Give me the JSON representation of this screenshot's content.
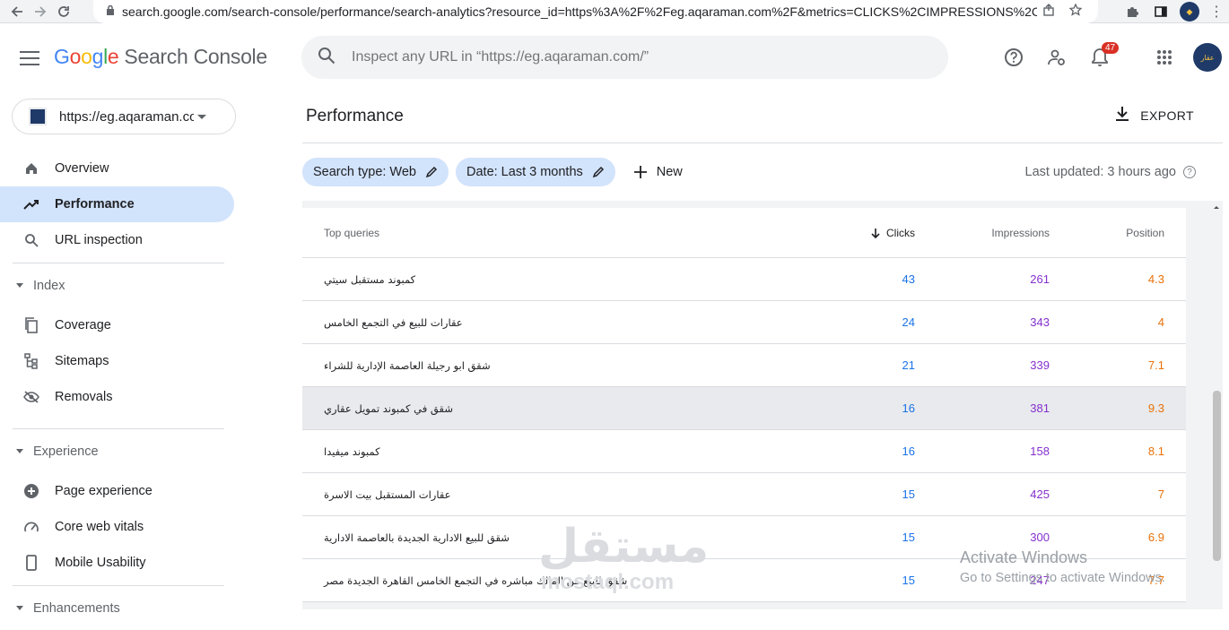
{
  "browser": {
    "url": "search.google.com/search-console/performance/search-analytics?resource_id=https%3A%2F%2Feg.aqaraman.com%2F&metrics=CLICKS%2CIMPRESSIONS%2CPO..."
  },
  "header": {
    "logo_google": [
      "G",
      "o",
      "o",
      "g",
      "l",
      "e"
    ],
    "logo_product": "Search Console",
    "search_placeholder": "Inspect any URL in “https://eg.aqaraman.com/”",
    "notifications_count": "47",
    "avatar_text": "عقار"
  },
  "sidebar": {
    "property": "https://eg.aqaraman.com/",
    "items": [
      {
        "label": "Overview",
        "icon": "home-icon"
      },
      {
        "label": "Performance",
        "icon": "trending-up-icon",
        "active": true
      },
      {
        "label": "URL inspection",
        "icon": "search-icon"
      }
    ],
    "sections": [
      {
        "label": "Index",
        "items": [
          {
            "label": "Coverage",
            "icon": "file-copy-icon"
          },
          {
            "label": "Sitemaps",
            "icon": "sitemap-icon"
          },
          {
            "label": "Removals",
            "icon": "eye-off-icon"
          }
        ]
      },
      {
        "label": "Experience",
        "items": [
          {
            "label": "Page experience",
            "icon": "add-circle-icon"
          },
          {
            "label": "Core web vitals",
            "icon": "speedometer-icon"
          },
          {
            "label": "Mobile Usability",
            "icon": "phone-icon"
          }
        ]
      },
      {
        "label": "Enhancements",
        "items": []
      }
    ]
  },
  "main": {
    "title": "Performance",
    "export_label": "EXPORT",
    "filters": [
      "Search type: Web",
      "Date: Last 3 months"
    ],
    "new_label": "New",
    "last_updated": "Last updated: 3 hours ago",
    "table": {
      "headers": [
        "Top queries",
        "Clicks",
        "Impressions",
        "Position"
      ],
      "rows": [
        {
          "query": "كمبوند مستقبل سيتي",
          "clicks": "43",
          "impressions": "261",
          "position": "4.3"
        },
        {
          "query": "عقارات للبيع في التجمع الخامس",
          "clicks": "24",
          "impressions": "343",
          "position": "4"
        },
        {
          "query": "شقق ابو رجيلة العاصمة الإدارية للشراء",
          "clicks": "21",
          "impressions": "339",
          "position": "7.1"
        },
        {
          "query": "شقق في كمبوند تمويل عقاري",
          "clicks": "16",
          "impressions": "381",
          "position": "9.3",
          "highlight": true
        },
        {
          "query": "كمبوند ميفيدا",
          "clicks": "16",
          "impressions": "158",
          "position": "8.1"
        },
        {
          "query": "عقارات المستقبل بيت الاسرة",
          "clicks": "15",
          "impressions": "425",
          "position": "7"
        },
        {
          "query": "شقق للبيع الادارية الجديدة بالعاصمة الادارية",
          "clicks": "15",
          "impressions": "300",
          "position": "6.9"
        },
        {
          "query": "شقق للبيع من المالك مباشره في التجمع الخامس القاهرة الجديدة مصر",
          "clicks": "15",
          "impressions": "247",
          "position": "7.7"
        }
      ]
    }
  },
  "overlay": {
    "watermark_ar": "مستقل",
    "watermark_en": "mostaql.com",
    "activation_title": "Activate Windows",
    "activation_sub": "Go to Settings to activate Windows."
  }
}
